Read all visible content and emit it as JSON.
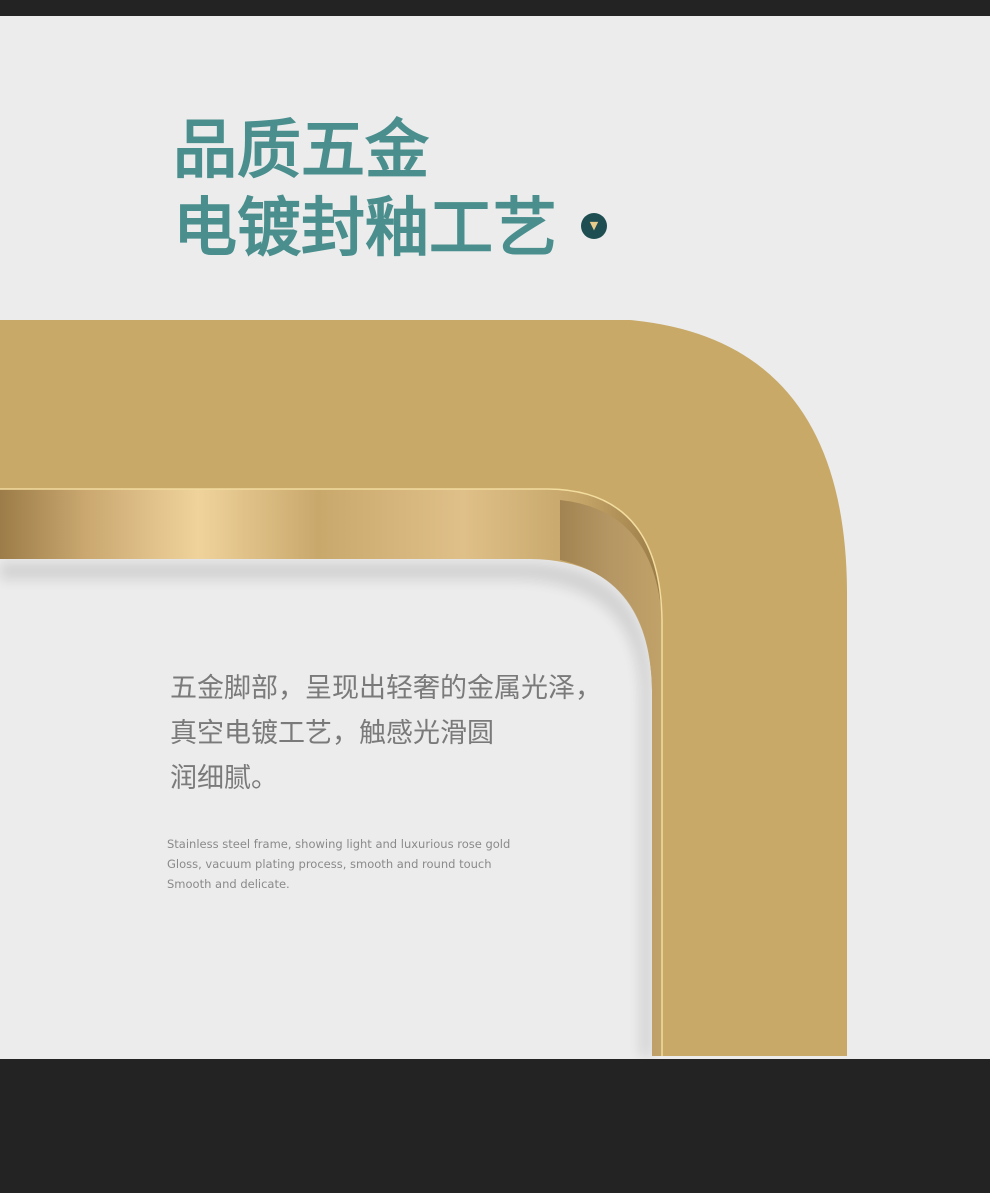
{
  "heading": {
    "line1": "品质五金",
    "line2": "电镀封釉工艺"
  },
  "badge": {
    "icon": "triangle-down-icon",
    "glyph": "▼"
  },
  "description_cn": {
    "line1": "五金脚部，呈现出轻奢的金属光泽，",
    "line2": "真空电镀工艺，触感光滑圆",
    "line3": "润细腻。"
  },
  "description_en": {
    "line1": "Stainless steel frame, showing light and luxurious rose gold",
    "line2": "Gloss, vacuum plating process, smooth and round touch",
    "line3": "Smooth and delicate."
  },
  "colors": {
    "background": "#ececec",
    "frame_bar": "#232323",
    "heading": "#4a8f8e",
    "gold": "#c8a967",
    "badge": "#1f4e52"
  }
}
